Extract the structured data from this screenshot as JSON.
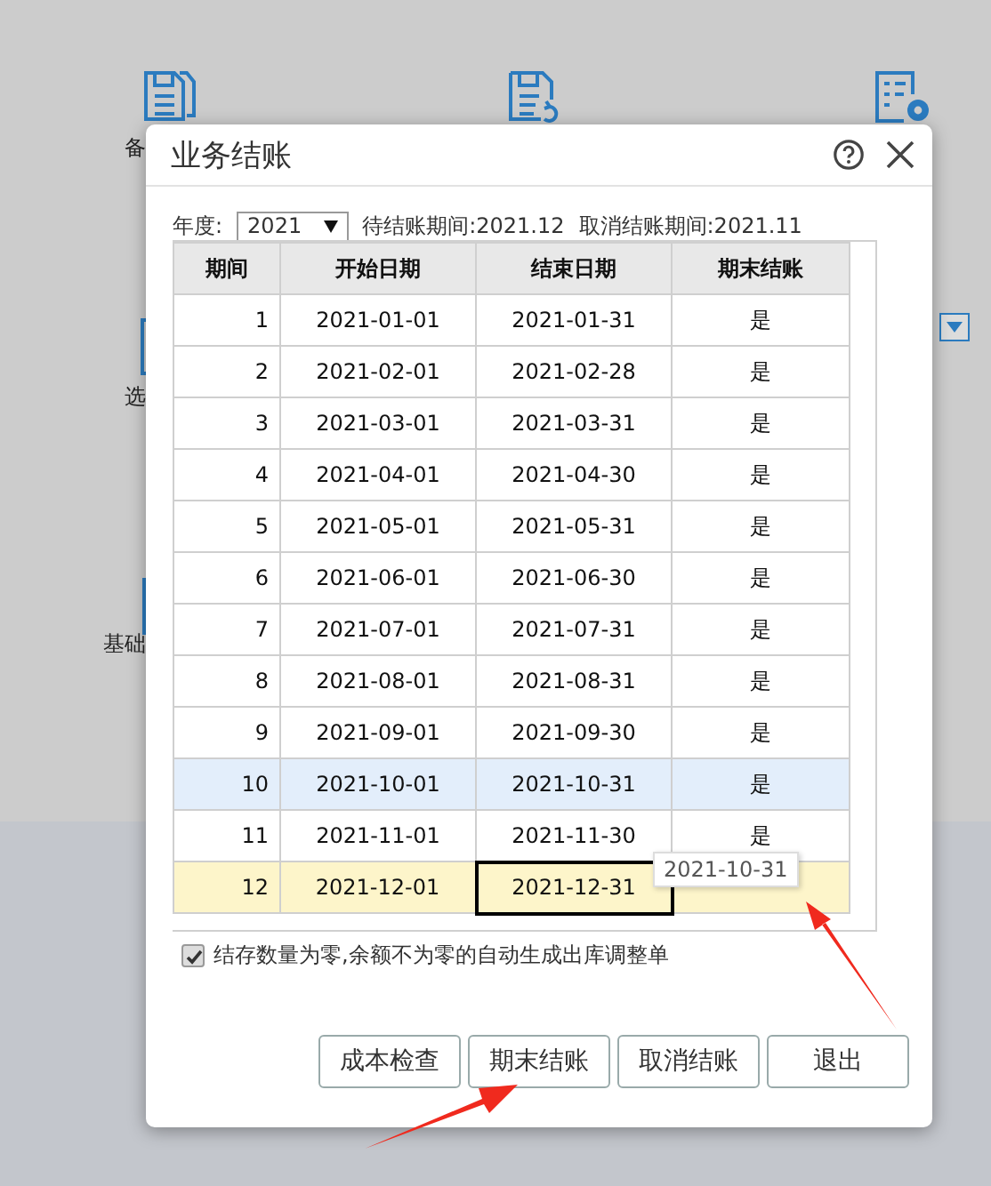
{
  "background": {
    "labels": [
      "备",
      "选",
      "基础"
    ]
  },
  "dialog": {
    "title": "业务结账",
    "year_label": "年度:",
    "year": "2021",
    "pending_label": "待结账期间:",
    "pending": "2021.12",
    "cancel_label": "取消结账期间:",
    "cancel": "2021.11",
    "table": {
      "columns": [
        "期间",
        "开始日期",
        "结束日期",
        "期末结账"
      ],
      "rows": [
        {
          "cells": [
            "1",
            "2021-01-01",
            "2021-01-31",
            "是"
          ],
          "selected": false,
          "hovered": false
        },
        {
          "cells": [
            "2",
            "2021-02-01",
            "2021-02-28",
            "是"
          ],
          "selected": false,
          "hovered": false
        },
        {
          "cells": [
            "3",
            "2021-03-01",
            "2021-03-31",
            "是"
          ],
          "selected": false,
          "hovered": false
        },
        {
          "cells": [
            "4",
            "2021-04-01",
            "2021-04-30",
            "是"
          ],
          "selected": false,
          "hovered": false
        },
        {
          "cells": [
            "5",
            "2021-05-01",
            "2021-05-31",
            "是"
          ],
          "selected": false,
          "hovered": false
        },
        {
          "cells": [
            "6",
            "2021-06-01",
            "2021-06-30",
            "是"
          ],
          "selected": false,
          "hovered": false
        },
        {
          "cells": [
            "7",
            "2021-07-01",
            "2021-07-31",
            "是"
          ],
          "selected": false,
          "hovered": false
        },
        {
          "cells": [
            "8",
            "2021-08-01",
            "2021-08-31",
            "是"
          ],
          "selected": false,
          "hovered": false
        },
        {
          "cells": [
            "9",
            "2021-09-01",
            "2021-09-30",
            "是"
          ],
          "selected": false,
          "hovered": false
        },
        {
          "cells": [
            "10",
            "2021-10-01",
            "2021-10-31",
            "是"
          ],
          "selected": false,
          "hovered": true
        },
        {
          "cells": [
            "11",
            "2021-11-01",
            "2021-11-30",
            "是"
          ],
          "selected": false,
          "hovered": false
        },
        {
          "cells": [
            "12",
            "2021-12-01",
            "2021-12-31",
            ""
          ],
          "selected": true,
          "hovered": false
        }
      ],
      "tooltip": "2021-10-31"
    },
    "option": {
      "label": "结存数量为零,余额不为零的自动生成出库调整单",
      "checked": true
    },
    "buttons": [
      "成本检查",
      "期末结账",
      "取消结账",
      "退出"
    ]
  }
}
